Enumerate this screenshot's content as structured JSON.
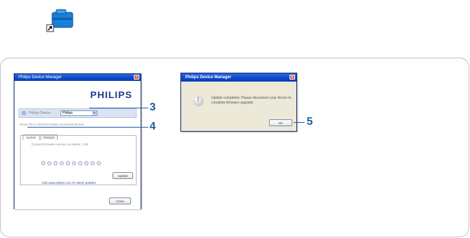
{
  "window": {
    "title": "Philips Device Manager",
    "brand": "PHILIPS",
    "device_label": "Philips Device",
    "device_value": "Philips",
    "hint": "Press F5 to check for newly connected devices",
    "tabs": [
      "Update",
      "Restore"
    ],
    "firmware_text": "Current Firmware version on device: 1.58",
    "update_button": "Update",
    "link_text": "Visit www.philips.com for latest updates",
    "close_button": "Close"
  },
  "dialog": {
    "title": "Philips Device Manager",
    "message": "Update completed. Please disconnect your device to complete firmware upgrade.",
    "ok_button": "OK"
  },
  "callouts": [
    "3",
    "4",
    "5"
  ],
  "icons": {
    "desktop_shortcut": "device-manager-shortcut-icon",
    "info": "exclamation-info-icon"
  },
  "colors": {
    "accent": "#1f5aa6",
    "titlebar": "#0d47c9",
    "brand": "#1c3f8d"
  }
}
